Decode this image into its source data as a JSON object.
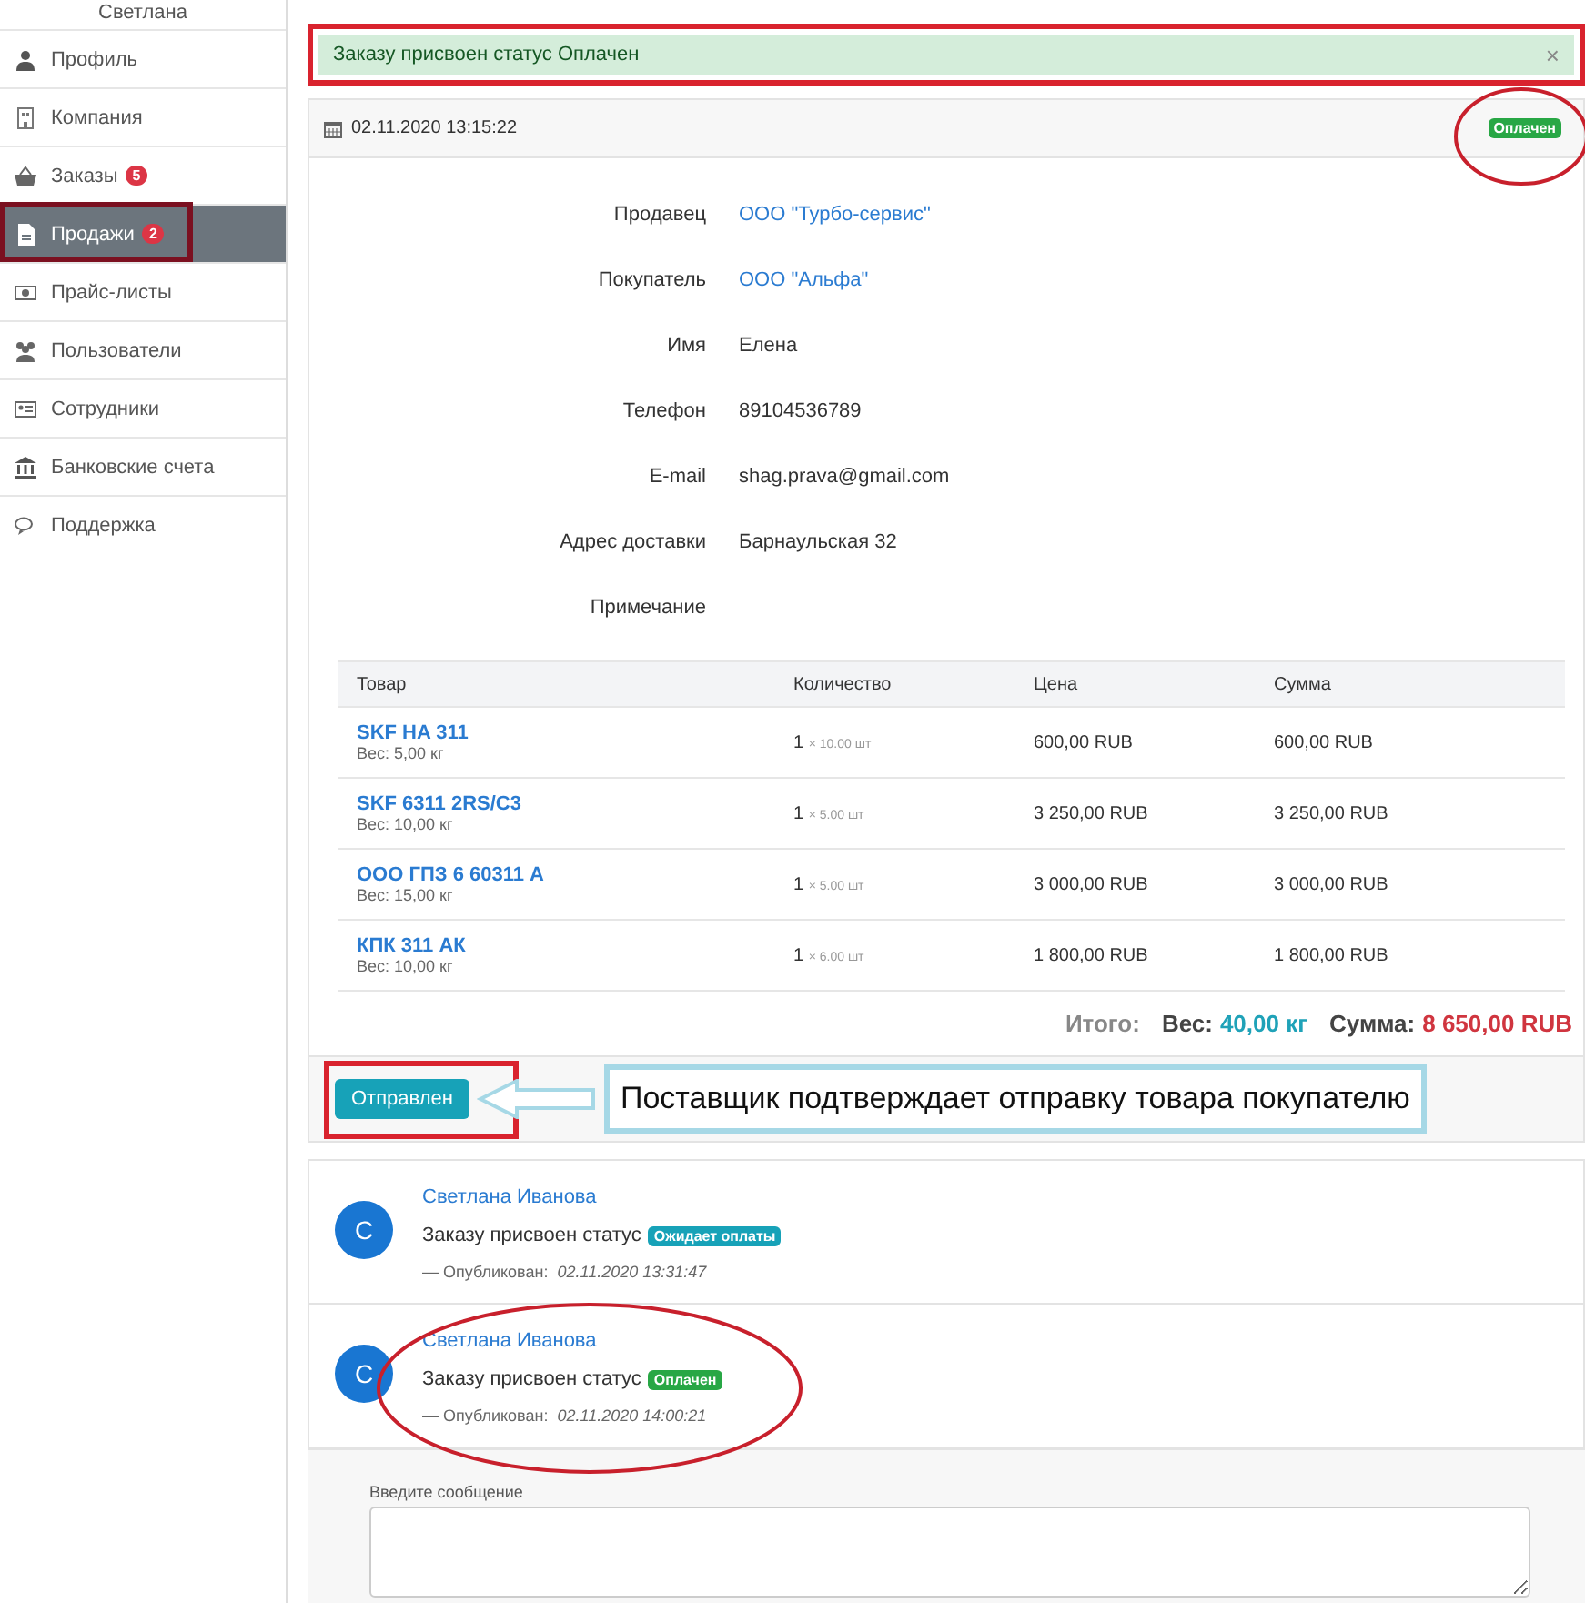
{
  "sidebar": {
    "user_name": "Светлана",
    "items": [
      {
        "label": "Профиль",
        "kind": "user",
        "selected": false,
        "highlighted": false
      },
      {
        "label": "Компания",
        "kind": "building",
        "selected": false,
        "highlighted": false
      },
      {
        "label": "Заказы",
        "kind": "basket",
        "badge": "5",
        "selected": false,
        "highlighted": false
      },
      {
        "label": "Продажи",
        "kind": "file",
        "badge": "2",
        "selected": true,
        "highlighted": true
      },
      {
        "label": "Прайс-листы",
        "kind": "money",
        "selected": false,
        "highlighted": false
      },
      {
        "label": "Пользователи",
        "kind": "users",
        "selected": false,
        "highlighted": false
      },
      {
        "label": "Сотрудники",
        "kind": "card",
        "selected": false,
        "highlighted": false
      },
      {
        "label": "Банковские счета",
        "kind": "bank",
        "selected": false,
        "highlighted": false
      },
      {
        "label": "Поддержка",
        "kind": "chat",
        "selected": false,
        "highlighted": false
      }
    ]
  },
  "alert": {
    "text": "Заказу присвоен статус Оплачен",
    "close": "×",
    "highlighted": true
  },
  "order": {
    "date": "02.11.2020 13:15:22",
    "status": {
      "label": "Оплачен",
      "color": "#28a745",
      "highlighted": true
    },
    "details": [
      {
        "label": "Продавец",
        "value": "ООО \"Турбо-сервис\"",
        "kind": "link"
      },
      {
        "label": "Покупатель",
        "value": "ООО \"Альфа\"",
        "kind": "link"
      },
      {
        "label": "Имя",
        "value": "Елена",
        "kind": "text"
      },
      {
        "label": "Телефон",
        "value": "89104536789",
        "kind": "text"
      },
      {
        "label": "E-mail",
        "value": "shag.prava@gmail.com",
        "kind": "text"
      },
      {
        "label": "Адрес доставки",
        "value": "Барнаульская 32",
        "kind": "text"
      },
      {
        "label": "Примечание"
      }
    ],
    "table": {
      "columns": [
        "Товар",
        "Количество",
        "Цена",
        "Сумма"
      ],
      "rows": [
        {
          "name": "SKF HA 311",
          "weight": "Вес: 5,00 кг",
          "qty": "1",
          "unit": "× 10.00 шт",
          "price": "600,00 RUB",
          "sum": "600,00 RUB"
        },
        {
          "name": "SKF 6311 2RS/C3",
          "weight": "Вес: 10,00 кг",
          "qty": "1",
          "unit": "× 5.00 шт",
          "price": "3 250,00 RUB",
          "sum": "3 250,00 RUB"
        },
        {
          "name": "ООО ГПЗ 6 60311 А",
          "weight": "Вес: 15,00 кг",
          "qty": "1",
          "unit": "× 5.00 шт",
          "price": "3 000,00 RUB",
          "sum": "3 000,00 RUB"
        },
        {
          "name": "КПК 311 АК",
          "weight": "Вес: 10,00 кг",
          "qty": "1",
          "unit": "× 6.00 шт",
          "price": "1 800,00 RUB",
          "sum": "1 800,00 RUB"
        }
      ]
    },
    "totals": {
      "label": "Итого:",
      "weight_label": "Вес:",
      "weight": "40,00 кг",
      "sum_label": "Сумма:",
      "sum": "8 650,00 RUB"
    },
    "action_button": {
      "label": "Отправлен",
      "highlighted": true
    },
    "callout": "Поставщик подтверждает отправку товара покупателю"
  },
  "comments": [
    {
      "avatar": "С",
      "author": "Светлана Иванова",
      "text": "Заказу присвоен статус",
      "status": {
        "label": "Ожидает оплаты",
        "color": "#17a2b8"
      },
      "published_label": "— Опубликован:",
      "date": "02.11.2020 13:31:47",
      "highlighted": false
    },
    {
      "avatar": "С",
      "author": "Светлана Иванова",
      "text": "Заказу присвоен статус",
      "status": {
        "label": "Оплачен",
        "color": "#28a745"
      },
      "published_label": "— Опубликован:",
      "date": "02.11.2020 14:00:21",
      "highlighted": true
    }
  ],
  "message": {
    "label": "Введите сообщение"
  }
}
